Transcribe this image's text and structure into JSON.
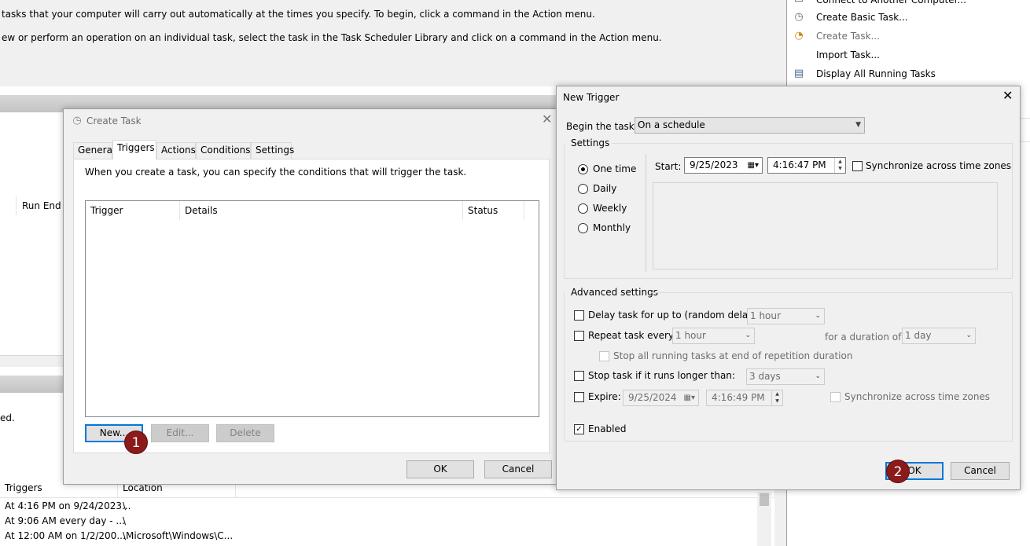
{
  "background": {
    "description_line1": "tasks that your computer will carry out automatically at the times you specify. To begin, click a command in the Action menu.",
    "description_line2": "ew or perform an operation on an individual task, select the task in the Task Scheduler Library and click on a command in the Action menu.",
    "run_end_header": "Run End",
    "partial_text": "ed.",
    "table_headers": [
      "Triggers",
      "Location"
    ],
    "rows": [
      {
        "triggers": "At 4:16 PM on 9/24/2023...",
        "location": "\\"
      },
      {
        "triggers": "At 9:06 AM every day - ...",
        "location": "\\"
      },
      {
        "triggers": "At 12:00 AM on 1/2/200...",
        "location": "\\Microsoft\\Windows\\C..."
      }
    ]
  },
  "actions": {
    "items": [
      {
        "label": "Connect to Another Computer...",
        "icon": "computer-icon"
      },
      {
        "label": "Create Basic Task...",
        "icon": "basic-task-icon"
      },
      {
        "label": "Create Task...",
        "icon": "create-task-icon"
      },
      {
        "label": "Import Task...",
        "icon": ""
      },
      {
        "label": "Display All Running Tasks",
        "icon": "running-tasks-icon"
      }
    ]
  },
  "create_task": {
    "title": "Create Task",
    "tabs": [
      "General",
      "Triggers",
      "Actions",
      "Conditions",
      "Settings"
    ],
    "active_tab": "Triggers",
    "intro": "When you create a task, you can specify the conditions that will trigger the task.",
    "columns": [
      "Trigger",
      "Details",
      "Status"
    ],
    "new_label": "New...",
    "edit_label": "Edit...",
    "delete_label": "Delete",
    "ok_label": "OK",
    "cancel_label": "Cancel"
  },
  "new_trigger": {
    "title": "New Trigger",
    "begin_label": "Begin the task:",
    "begin_value": "On a schedule",
    "settings_label": "Settings",
    "radios": [
      "One time",
      "Daily",
      "Weekly",
      "Monthly"
    ],
    "selected_radio": "One time",
    "start_label": "Start:",
    "start_date": "9/25/2023",
    "start_time": "4:16:47 PM",
    "sync_label": "Synchronize across time zones",
    "advanced_label": "Advanced settings",
    "delay_label": "Delay task for up to (random delay):",
    "delay_value": "1 hour",
    "repeat_label": "Repeat task every:",
    "repeat_value": "1 hour",
    "duration_label": "for a duration of:",
    "duration_value": "1 day",
    "stop_running_label": "Stop all running tasks at end of repetition duration",
    "stop_longer_label": "Stop task if it runs longer than:",
    "stop_longer_value": "3 days",
    "expire_label": "Expire:",
    "expire_date": "9/25/2024",
    "expire_time": "4:16:49 PM",
    "expire_sync_label": "Synchronize across time zones",
    "enabled_label": "Enabled",
    "enabled_check": "✓",
    "ok_label": "OK",
    "cancel_label": "Cancel"
  },
  "badges": [
    "1",
    "2"
  ]
}
